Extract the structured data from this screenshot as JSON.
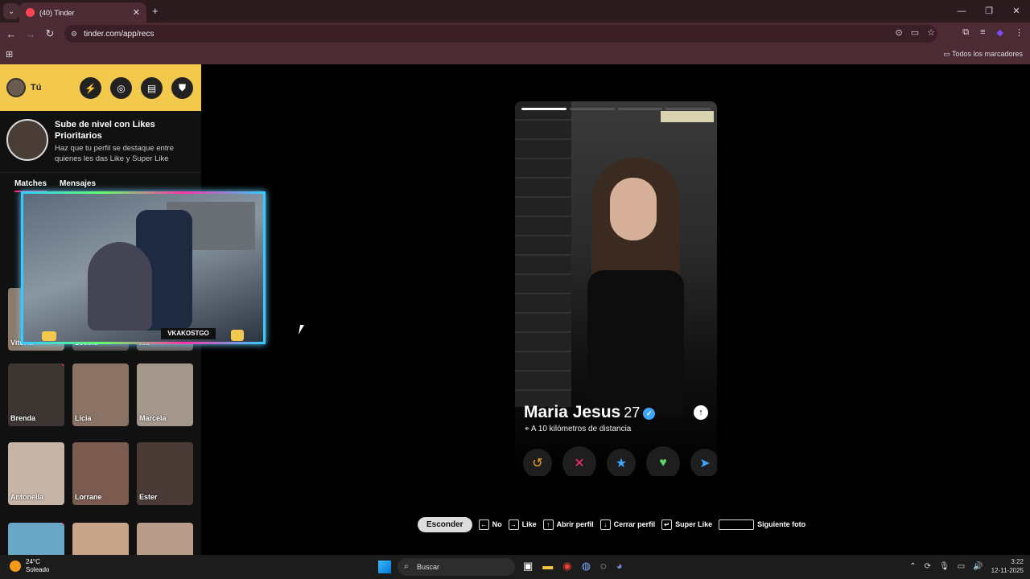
{
  "browser": {
    "tab_title": "(40) Tinder",
    "url": "tinder.com/app/recs",
    "bookmarks_label": "Todos los marcadores"
  },
  "sidebar": {
    "user_label": "Tú",
    "promo_title": "Sube de nivel con Likes Prioritarios",
    "promo_text": "Haz que tu perfil se destaque entre quienes les das Like y Super Like",
    "tabs": [
      "Matches",
      "Mensajes"
    ],
    "matches": [
      {
        "name": "Vitória",
        "color": "#8d7b6c"
      },
      {
        "name": "Letícia",
        "color": "#5a4a44"
      },
      {
        "name": "...a",
        "color": "#6e6059"
      },
      {
        "name": "Brenda",
        "color": "#3c3532"
      },
      {
        "name": "Lícia",
        "color": "#8a7364"
      },
      {
        "name": "Marcela",
        "color": "#a4988c"
      },
      {
        "name": "Antonella",
        "color": "#c6b4a6"
      },
      {
        "name": "Lorrane",
        "color": "#7b5b4f"
      },
      {
        "name": "Ester",
        "color": "#4b3b36"
      },
      {
        "name": "",
        "color": "#6aa7c7"
      },
      {
        "name": "",
        "color": "#c8a48b"
      },
      {
        "name": "",
        "color": "#b89b88"
      }
    ]
  },
  "stream_overlay": {
    "channel": "VKAKOSTGO"
  },
  "profile": {
    "name": "Maria Jesus",
    "age": "27",
    "distance": "A 10 kilómetros de distancia"
  },
  "shortcuts": {
    "hide": "Esconder",
    "no": "No",
    "like": "Like",
    "open": "Abrir perfil",
    "close": "Cerrar perfil",
    "super": "Super Like",
    "next": "Siguiente foto"
  },
  "taskbar": {
    "temp": "24°C",
    "weather": "Soleado",
    "search": "Buscar",
    "time": "3:22",
    "date": "12-11-2025"
  }
}
